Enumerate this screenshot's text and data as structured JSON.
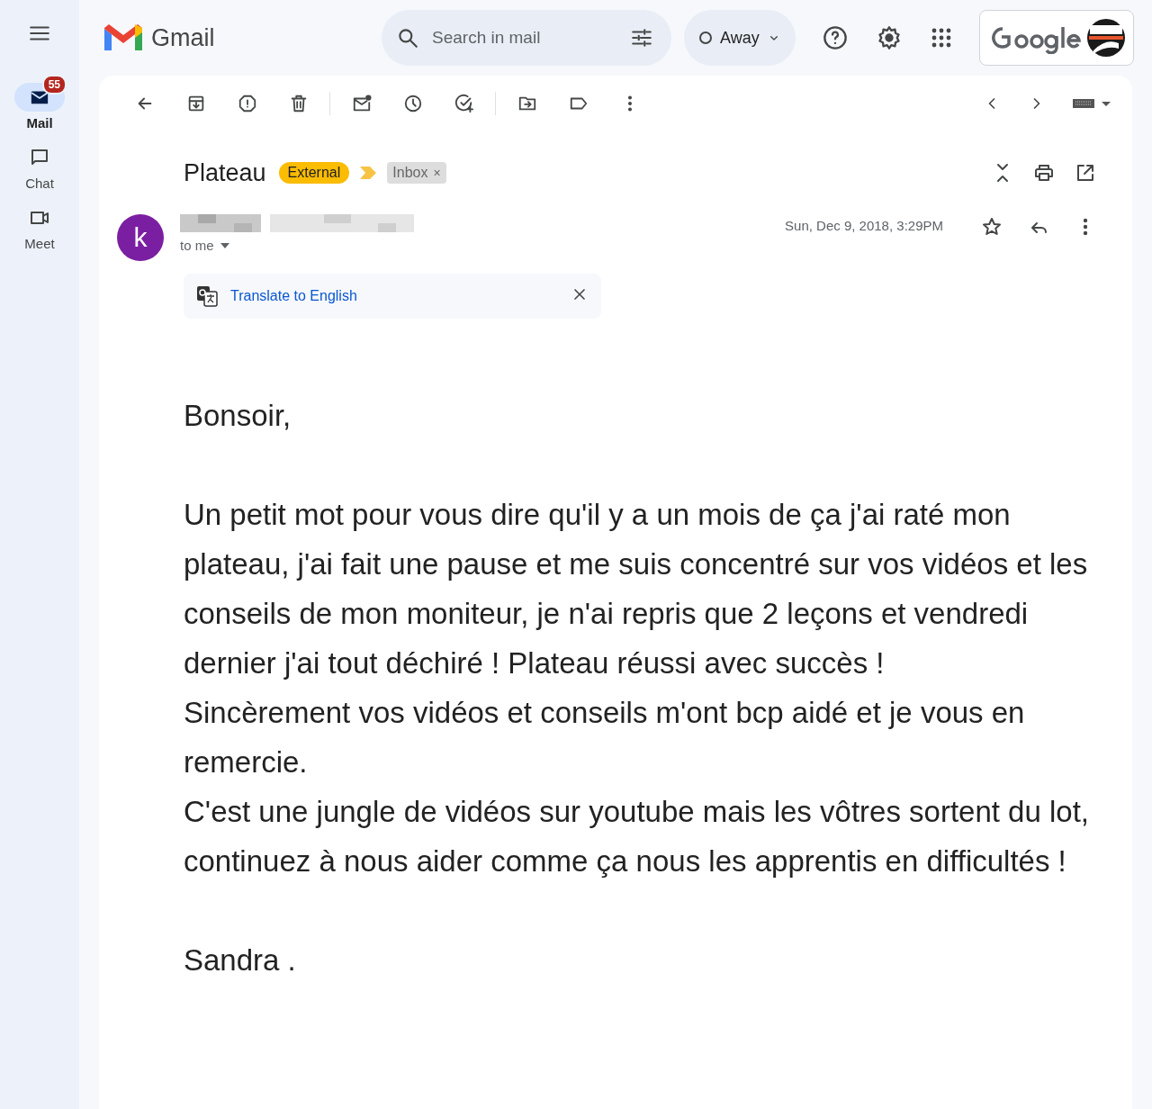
{
  "sidebar": {
    "items": [
      {
        "label": "Mail",
        "kind": "mail",
        "selected": true,
        "badge": "55"
      },
      {
        "label": "Chat",
        "kind": "chat",
        "selected": false
      },
      {
        "label": "Meet",
        "kind": "meet",
        "selected": false
      }
    ]
  },
  "header": {
    "product": "Gmail",
    "search": {
      "placeholder": "Search in mail"
    },
    "status": "Away"
  },
  "message": {
    "subject": "Plateau",
    "important": true,
    "labels": [
      {
        "text": "External",
        "kind": "tag"
      },
      {
        "text": "Inbox",
        "kind": "removable",
        "remove_icon": "×"
      }
    ],
    "avatar_initial": "k",
    "recipient": "to me",
    "date": "Sun, Dec 9, 2018, 3:29PM",
    "starred": false,
    "translate": "Translate to English",
    "body_blocks": [
      [
        "Bonsoir,"
      ],
      [
        "Un petit mot pour vous dire qu'il y a un mois de ça j'ai raté mon plateau, j'ai fait une pause et me suis concentré sur vos vidéos et les conseils de mon moniteur, je n'ai repris que 2 leçons et vendredi dernier j'ai tout déchiré ! Plateau réussi avec succès !",
        "Sincèrement vos vidéos et conseils m'ont bcp aidé et je vous en remercie.",
        "C'est une jungle de vidéos sur youtube mais les vôtres sortent du lot, continuez à nous aider comme ça nous les apprentis en difficultés !"
      ],
      [
        "Sandra ."
      ]
    ]
  }
}
